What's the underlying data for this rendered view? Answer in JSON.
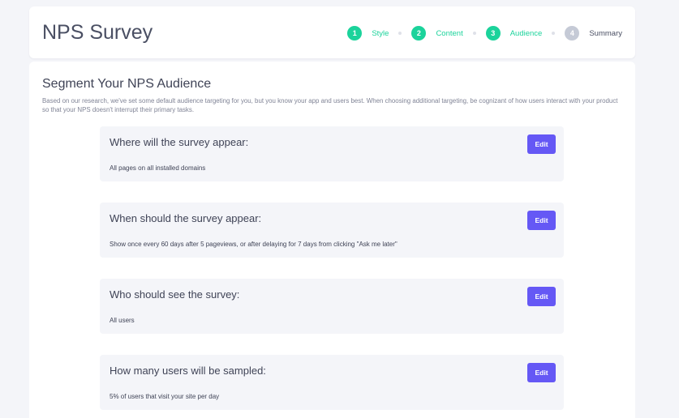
{
  "header": {
    "title": "NPS Survey"
  },
  "stepper": {
    "steps": [
      {
        "number": "1",
        "label": "Style",
        "status": "completed"
      },
      {
        "number": "2",
        "label": "Content",
        "status": "completed"
      },
      {
        "number": "3",
        "label": "Audience",
        "status": "current"
      },
      {
        "number": "4",
        "label": "Summary",
        "status": "upcoming"
      }
    ],
    "colors": {
      "completed_circle": "#1bd39b",
      "completed_label": "#1bd39b",
      "upcoming_circle": "#c5cad6",
      "upcoming_label": "#4a4f63"
    }
  },
  "main": {
    "title": "Segment Your NPS Audience",
    "description": "Based on our research, we've set some default audience targeting for you, but you know your app and users best. When choosing additional targeting, be cognizant of how users interact with your product so that your NPS doesn't interrupt their primary tasks.",
    "edit_label": "Edit",
    "settings": [
      {
        "question": "Where will the survey appear:",
        "value": "All pages on all installed domains"
      },
      {
        "question": "When should the survey appear:",
        "value": "Show once every 60 days after 5 pageviews, or after delaying for 7 days from clicking \"Ask me later\""
      },
      {
        "question": "Who should see the survey:",
        "value": "All users"
      },
      {
        "question": "How many users will be sampled:",
        "value": "5% of users that visit your site per day"
      }
    ]
  },
  "theme": {
    "accent": "#6558f5",
    "success": "#1bd39b",
    "background": "#f4f5f9"
  }
}
